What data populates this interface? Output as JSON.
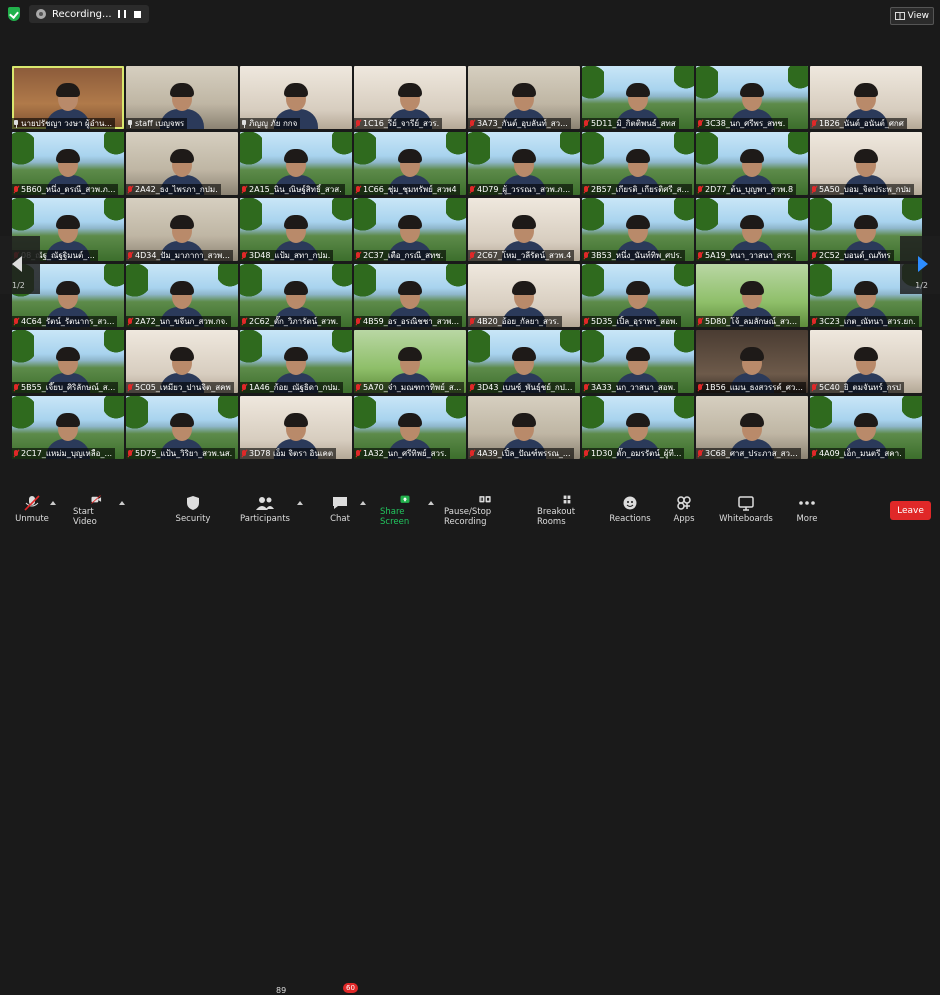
{
  "topbar": {
    "recording_label": "Recording...",
    "view_label": "View"
  },
  "grid": {
    "page_left": "1/2",
    "page_right": "1/2",
    "tiles": [
      {
        "name": "นายปรัชญา วงษา ผู้อำน...",
        "bg": "bg-h",
        "pin": true,
        "active": true
      },
      {
        "name": "staff เบญจพร",
        "bg": "bg-o",
        "pin": true
      },
      {
        "name": "ภิญญู ภัย กกจ",
        "bg": "bg-w",
        "pin": true
      },
      {
        "name": "1C16_รีย์_จารีย์_สวร.",
        "bg": "bg-w",
        "mic": true
      },
      {
        "name": "3A73_กันต์_อุบลันท์_สว...",
        "bg": "bg-o",
        "mic": true
      },
      {
        "name": "5D11_มิ_กิตติพนธ์_สทส",
        "bg": "bg-v",
        "mic": true
      },
      {
        "name": "3C38_นก_ศรีพร_สทช.",
        "bg": "bg-v",
        "mic": true
      },
      {
        "name": "1B26_นันต์_อนันต์_ศกศ",
        "bg": "bg-w",
        "mic": true
      },
      {
        "name": "5B60_หนึ่ง_ดรณี_สวพ.ภ...",
        "bg": "bg-v",
        "mic": true
      },
      {
        "name": "2A42_ธง_ไพรภา_กปม.",
        "bg": "bg-o",
        "mic": true
      },
      {
        "name": "2A15_นิน_ณิษฐ์สิทธิ์_สวส.",
        "bg": "bg-v",
        "mic": true
      },
      {
        "name": "1C66_ชุ่ม_ชุมทรัพย์_สวพ4",
        "bg": "bg-v",
        "mic": true
      },
      {
        "name": "4D79_ผู้_วรรณา_สวพ.ภ...",
        "bg": "bg-v",
        "mic": true
      },
      {
        "name": "2B57_เกียรติ_เกียรติศรี_ส...",
        "bg": "bg-v",
        "mic": true
      },
      {
        "name": "2D77_ต้น_บุญพา_สวพ.8",
        "bg": "bg-v",
        "mic": true
      },
      {
        "name": "5A50_บอม_จิตประพ_กปม",
        "bg": "bg-w",
        "mic": true
      },
      {
        "name": "08_ณัฐ_ณัฐฐิมนต์_...",
        "bg": "bg-v",
        "mic": true
      },
      {
        "name": "4D34_ปัม_มาภากา_สวพ...",
        "bg": "bg-o",
        "mic": true
      },
      {
        "name": "3D48_แป้ม_สทา_กปม.",
        "bg": "bg-v",
        "mic": true
      },
      {
        "name": "2C37_เตือ_กรณี_สทช.",
        "bg": "bg-v",
        "mic": true
      },
      {
        "name": "2C67_โหม_วลีรัตน์_สวพ.4",
        "bg": "bg-w",
        "mic": true
      },
      {
        "name": "3B53_หนึ่ง_นันท์ทิพ_ศปร.",
        "bg": "bg-v",
        "mic": true
      },
      {
        "name": "5A19_หนา_วาสนา_สวร.",
        "bg": "bg-v",
        "mic": true
      },
      {
        "name": "2C52_บอนด์_ณภัทร",
        "bg": "bg-v",
        "mic": true
      },
      {
        "name": "4C64_รัตน์_รัตนากร_สว...",
        "bg": "bg-v",
        "mic": true
      },
      {
        "name": "2A72_นก_ขจีนก_สวพ.กจ.",
        "bg": "bg-v",
        "mic": true
      },
      {
        "name": "2C62_ตั๊ก_วิภารัตน์_สวพ.",
        "bg": "bg-v",
        "mic": true
      },
      {
        "name": "4B59_อร_อรณิชชา_สวพ...",
        "bg": "bg-v",
        "mic": true
      },
      {
        "name": "4B20_อ้อย_กัลยา_สวร.",
        "bg": "bg-w",
        "mic": true
      },
      {
        "name": "5D35_เปิ้ล_อุราพร_สอพ.",
        "bg": "bg-v",
        "mic": true
      },
      {
        "name": "5D80_โจ้_ลมลักษณ์_สว...",
        "bg": "bg-g",
        "mic": true
      },
      {
        "name": "3C23_เกต_ณัทนา_สวร.ยก.",
        "bg": "bg-v",
        "mic": true
      },
      {
        "name": "5B55_เจี๊ยบ_ศิริลักษณ์_ส...",
        "bg": "bg-v",
        "mic": true
      },
      {
        "name": "5C05_เหมียว_ปานจิต_สคพ",
        "bg": "bg-w",
        "mic": true
      },
      {
        "name": "1A46_ก้อย_ณัฐธิดา_กปม.",
        "bg": "bg-v",
        "mic": true
      },
      {
        "name": "5A70_จ๋า_มณฑกาทิพย์_ส...",
        "bg": "bg-g",
        "mic": true
      },
      {
        "name": "3D43_เบนซ์_พันธุ์ชย์_กป...",
        "bg": "bg-v",
        "mic": true
      },
      {
        "name": "3A33_นก_วาสนา_สอพ.",
        "bg": "bg-v",
        "mic": true
      },
      {
        "name": "1B56_แมน_ธงสวรรค์_ศว...",
        "bg": "bg-d",
        "mic": true
      },
      {
        "name": "5C40_ยิ_ตมจันทร์_กรป",
        "bg": "bg-w",
        "mic": true
      },
      {
        "name": "2C17_แหม่ม_บุญเหลือ_...",
        "bg": "bg-v",
        "mic": true
      },
      {
        "name": "5D75_แป้น_วิริยา_สวพ.นส.",
        "bg": "bg-v",
        "mic": true
      },
      {
        "name": "3D78 เอ็ม จิตรา อินเคต",
        "bg": "bg-w",
        "mic": true
      },
      {
        "name": "1A32_นก_ศรีทิพย์_สวร.",
        "bg": "bg-v",
        "mic": true
      },
      {
        "name": "4A39_เปิ้ล_ปัณฑ์พรรณ_...",
        "bg": "bg-o",
        "mic": true
      },
      {
        "name": "1D30_ตั๊ก_อมรรัตน์_ผู้ที...",
        "bg": "bg-v",
        "mic": true
      },
      {
        "name": "3C68_ศาส_ประภาส_สว...",
        "bg": "bg-o",
        "mic": true
      },
      {
        "name": "4A09_เอ็ก_มนตรี_สคา.",
        "bg": "bg-v",
        "mic": true
      }
    ]
  },
  "toolbar": {
    "unmute": "Unmute",
    "start_video": "Start Video",
    "security": "Security",
    "participants": "Participants",
    "participants_count": "89",
    "chat": "Chat",
    "chat_badge": "60",
    "share_screen": "Share Screen",
    "record": "Pause/Stop Recording",
    "breakout": "Breakout Rooms",
    "reactions": "Reactions",
    "apps": "Apps",
    "whiteboards": "Whiteboards",
    "more": "More",
    "leave": "Leave"
  }
}
